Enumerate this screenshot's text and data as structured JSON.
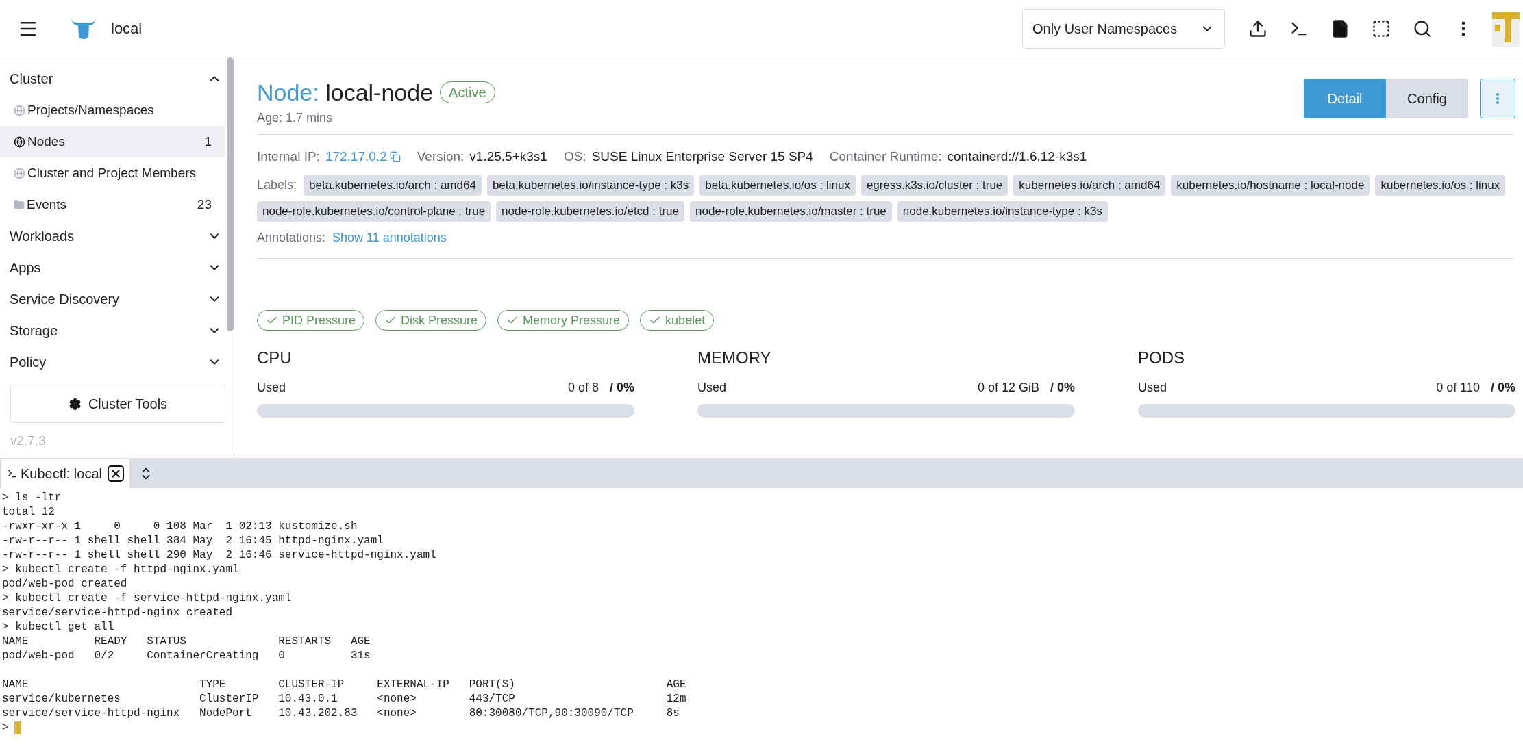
{
  "header": {
    "cluster_name": "local",
    "namespace_filter": "Only User Namespaces"
  },
  "sidebar": {
    "groups": [
      {
        "label": "Cluster",
        "expanded": true,
        "children": [
          {
            "label": "Projects/Namespaces",
            "kind": "globe",
            "selected": false
          },
          {
            "label": "Nodes",
            "kind": "globe",
            "count": "1",
            "selected": true
          },
          {
            "label": "Cluster and Project Members",
            "kind": "globe",
            "selected": false
          },
          {
            "label": "Events",
            "kind": "folder",
            "count": "23",
            "selected": false
          }
        ]
      },
      {
        "label": "Workloads",
        "expanded": false
      },
      {
        "label": "Apps",
        "expanded": false
      },
      {
        "label": "Service Discovery",
        "expanded": false
      },
      {
        "label": "Storage",
        "expanded": false
      },
      {
        "label": "Policy",
        "expanded": false
      }
    ],
    "tools_button": "Cluster Tools",
    "version": "v2.7.3"
  },
  "page": {
    "type_label": "Node:",
    "name": "local-node",
    "status": "Active",
    "age": "Age: 1.7 mins",
    "view_tabs": [
      {
        "label": "Detail",
        "selected": true
      },
      {
        "label": "Config",
        "selected": false
      }
    ],
    "details": [
      {
        "label": "Internal IP:",
        "value": "172.17.0.2",
        "kind": "link"
      },
      {
        "label": "Version:",
        "value": "v1.25.5+k3s1",
        "kind": "text"
      },
      {
        "label": "OS:",
        "value": "SUSE Linux Enterprise Server 15 SP4",
        "kind": "text"
      },
      {
        "label": "Container Runtime:",
        "value": "containerd://1.6.12-k3s1",
        "kind": "text"
      }
    ],
    "labels_title": "Labels:",
    "labels": [
      "beta.kubernetes.io/arch : amd64",
      "beta.kubernetes.io/instance-type : k3s",
      "beta.kubernetes.io/os : linux",
      "egress.k3s.io/cluster : true",
      "kubernetes.io/arch : amd64",
      "kubernetes.io/hostname : local-node",
      "kubernetes.io/os : linux",
      "node-role.kubernetes.io/control-plane : true",
      "node-role.kubernetes.io/etcd : true",
      "node-role.kubernetes.io/master : true",
      "node.kubernetes.io/instance-type : k3s"
    ],
    "annotations_title": "Annotations:",
    "annotations_link": "Show 11 annotations",
    "conditions": [
      "PID Pressure",
      "Disk Pressure",
      "Memory Pressure",
      "kubelet"
    ],
    "gauges": [
      {
        "title": "CPU",
        "used_label": "Used",
        "amount": "0 of 8",
        "percent": "/ 0%",
        "level": 0
      },
      {
        "title": "MEMORY",
        "used_label": "Used",
        "amount": "0 of 12 GiB",
        "percent": "/ 0%",
        "level": 0
      },
      {
        "title": "PODS",
        "used_label": "Used",
        "amount": "0 of 110",
        "percent": "/ 0%",
        "level": 0
      }
    ]
  },
  "terminal": {
    "tab_label": "Kubectl: local",
    "blocks": [
      [
        "> ls -ltr",
        "total 12",
        "-rwxr-xr-x 1     0     0 108 Mar  1 02:13 kustomize.sh",
        "-rw-r--r-- 1 shell shell 384 May  2 16:45 httpd-nginx.yaml",
        "-rw-r--r-- 1 shell shell 290 May  2 16:46 service-httpd-nginx.yaml",
        "> kubectl create -f httpd-nginx.yaml",
        "pod/web-pod created",
        "> kubectl create -f service-httpd-nginx.yaml",
        "service/service-httpd-nginx created",
        "> kubectl get all",
        "NAME          READY   STATUS              RESTARTS   AGE",
        "pod/web-pod   0/2     ContainerCreating   0          31s"
      ],
      [
        "NAME                          TYPE        CLUSTER-IP     EXTERNAL-IP   PORT(S)                       AGE",
        "service/kubernetes            ClusterIP   10.43.0.1      <none>        443/TCP                       12m",
        "service/service-httpd-nginx   NodePort    10.43.202.83   <none>        80:30080/TCP,90:30090/TCP     8s"
      ]
    ],
    "prompt": ">"
  }
}
